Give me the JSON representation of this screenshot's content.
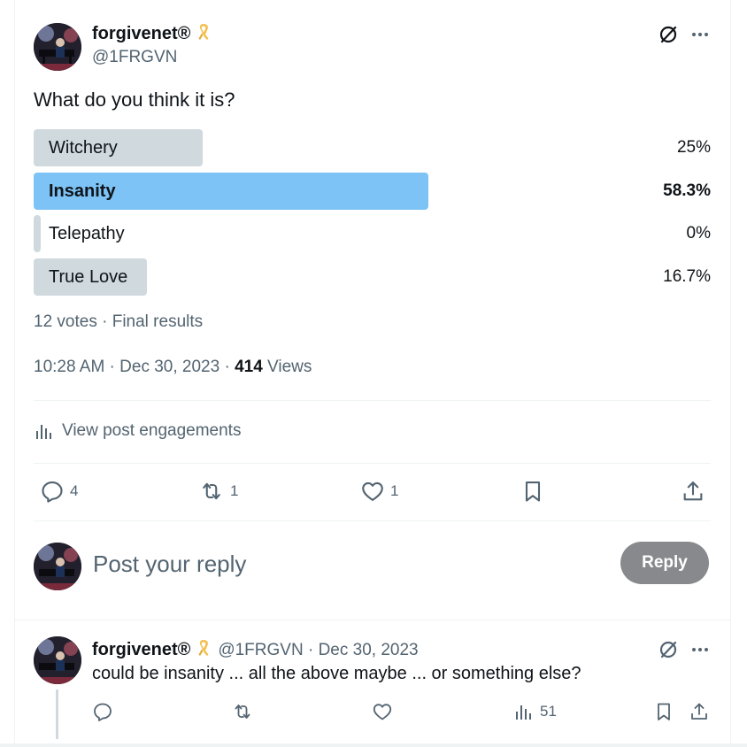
{
  "post": {
    "author_name": "forgivenet®",
    "author_handle": "@1FRGVN",
    "question": "What do you think it is?",
    "poll": [
      {
        "label": "Witchery",
        "percent": "25%",
        "fraction": 0.25,
        "winner": false
      },
      {
        "label": "Insanity",
        "percent": "58.3%",
        "fraction": 0.583,
        "winner": true
      },
      {
        "label": "Telepathy",
        "percent": "0%",
        "fraction": 0.0,
        "winner": false
      },
      {
        "label": "True Love",
        "percent": "16.7%",
        "fraction": 0.167,
        "winner": false
      }
    ],
    "votes_summary": "12 votes · Final results",
    "timestamp": "10:28 AM · Dec 30, 2023 · ",
    "views_count": "414",
    "views_label": " Views",
    "engagements_label": "View post engagements",
    "actions": {
      "replies": "4",
      "reposts": "1",
      "likes": "1"
    }
  },
  "composer": {
    "placeholder": "Post your reply",
    "button_label": "Reply"
  },
  "reply": {
    "author_name": "forgivenet®",
    "author_handle": "@1FRGVN",
    "date": " · Dec 30, 2023",
    "text": "could be insanity ... all the above maybe ... or something else?",
    "views": "51"
  },
  "colors": {
    "winner_bar": "#7dc3f6",
    "bar": "#cfd9de",
    "secondary_text": "#536471",
    "reply_button": "#87898c",
    "ribbon": "#f4c04e"
  },
  "icons": [
    "ribbon-icon",
    "grok-slash-icon",
    "more-icon",
    "analytics-icon",
    "comment-icon",
    "repost-icon",
    "heart-icon",
    "bookmark-icon",
    "share-icon"
  ]
}
